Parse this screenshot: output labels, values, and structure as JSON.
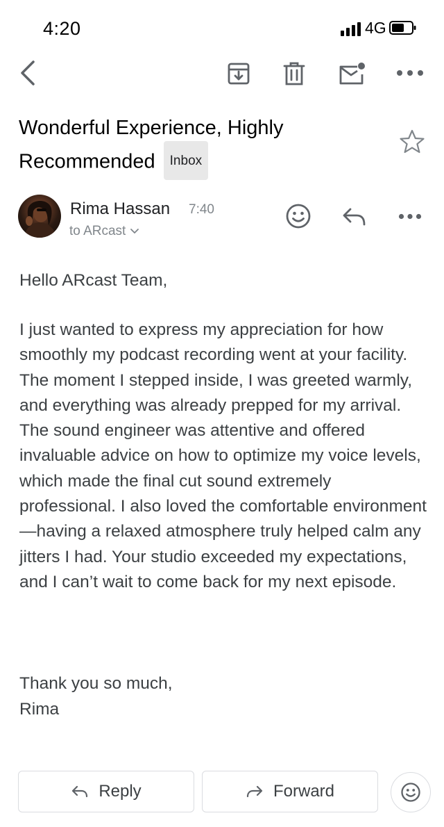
{
  "status_bar": {
    "time": "4:20",
    "network": "4G",
    "icons": [
      "signal-bars-icon",
      "battery-icon"
    ]
  },
  "toolbar": {
    "icons": [
      "back-arrow-icon",
      "archive-icon",
      "trash-icon",
      "mark-unread-icon",
      "more-horizontal-icon"
    ]
  },
  "email": {
    "subject": "Wonderful Experience, Highly Recommended",
    "label": "Inbox",
    "sender_name": "Rima Hassan",
    "time": "7:40",
    "recipient": "to ARcast",
    "greeting": "Hello ARcast Team,",
    "body": "I just wanted to express my appreciation for how smoothly my podcast recording went at your facility. The moment I stepped inside, I was greeted warmly, and everything was already prepped for my arrival. The sound engineer was attentive and offered invaluable advice on how to optimize my voice levels, which made the final cut sound extremely professional. I also loved the comfortable environment—having a relaxed atmosphere truly helped calm any jitters I had. Your studio exceeded my expectations, and I can’t wait to come back for my next episode.",
    "closing": "Thank you so much,",
    "signature": "Rima"
  },
  "actions": {
    "reply": "Reply",
    "forward": "Forward"
  },
  "colors": {
    "icon_gray": "#5f6368",
    "secondary_text": "#80868b",
    "body_text": "#3c4043",
    "badge_bg": "#e8e8e8",
    "border": "#dadce0"
  }
}
